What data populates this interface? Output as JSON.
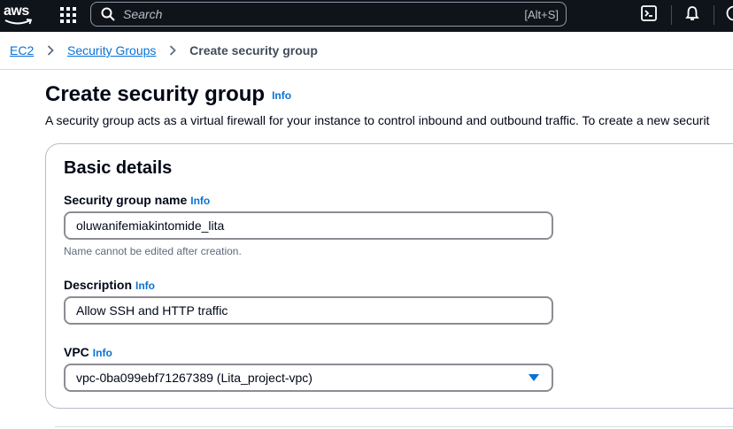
{
  "topnav": {
    "logo_text": "aws",
    "search_placeholder": "Search",
    "search_shortcut": "[Alt+S]"
  },
  "breadcrumb": {
    "items": [
      "EC2",
      "Security Groups"
    ],
    "current": "Create security group"
  },
  "header": {
    "title": "Create security group",
    "info": "Info",
    "description": "A security group acts as a virtual firewall for your instance to control inbound and outbound traffic. To create a new securit"
  },
  "basic_details": {
    "title": "Basic details",
    "name": {
      "label": "Security group name",
      "info": "Info",
      "value": "oluwanifemiakintomide_lita",
      "hint": "Name cannot be edited after creation."
    },
    "description": {
      "label": "Description",
      "info": "Info",
      "value": "Allow SSH and HTTP traffic"
    },
    "vpc": {
      "label": "VPC",
      "info": "Info",
      "value": "vpc-0ba099ebf71267389 (Lita_project-vpc)"
    }
  },
  "colors": {
    "nav_bg": "#0f141a",
    "link": "#0972d3",
    "text": "#000716"
  }
}
